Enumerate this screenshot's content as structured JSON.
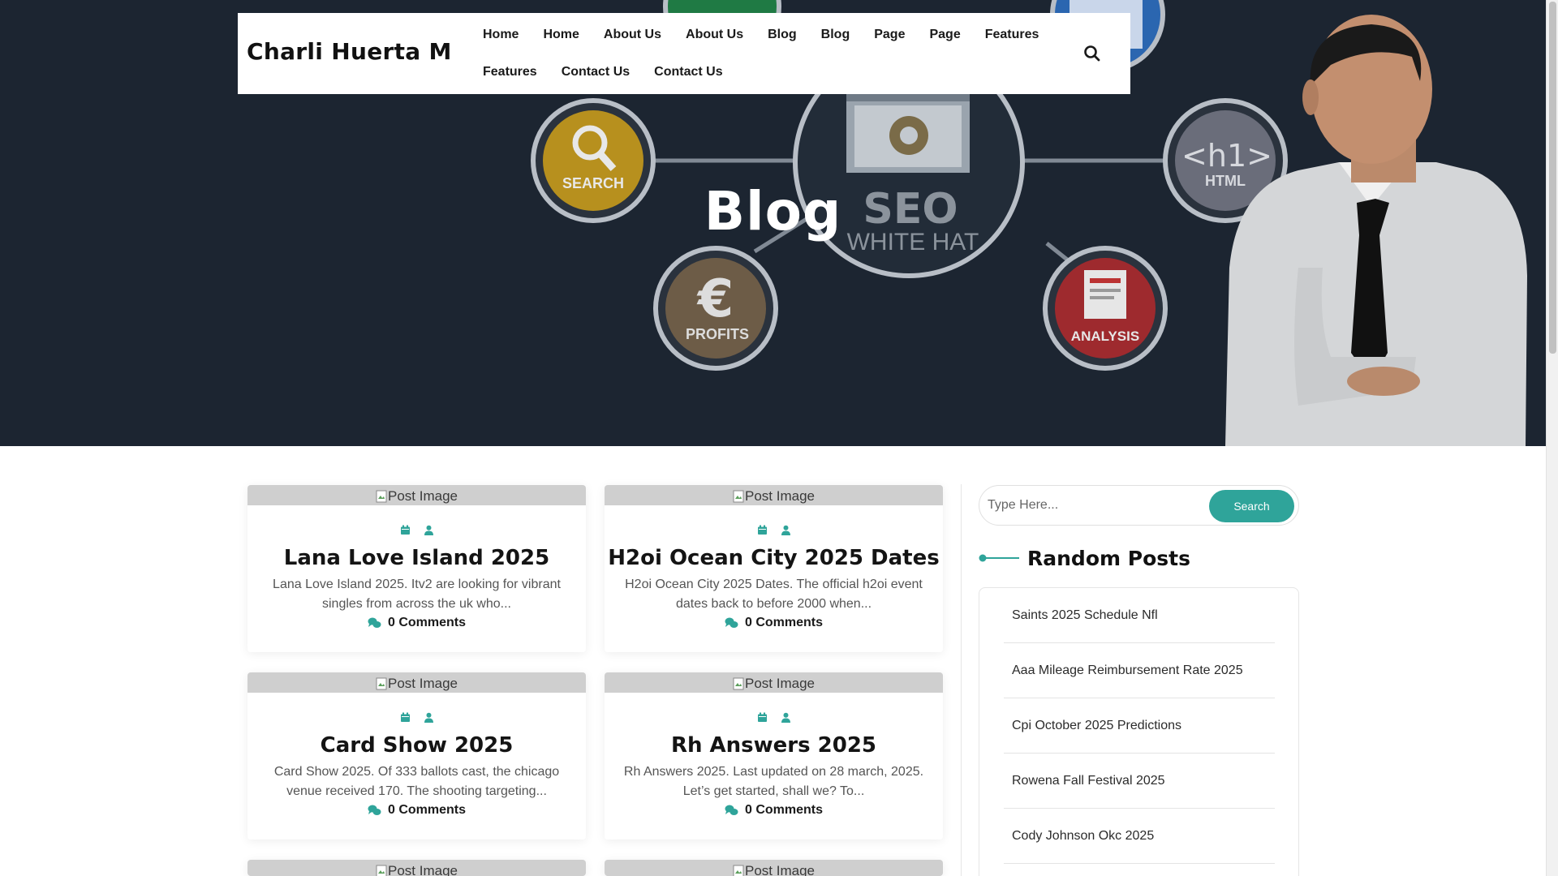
{
  "site": {
    "title": "Charli Huerta M"
  },
  "nav": {
    "row1": [
      "Home",
      "Home",
      "About Us",
      "About Us",
      "Blog",
      "Blog",
      "Page",
      "Page",
      "Features"
    ],
    "row2": [
      "Features",
      "Contact Us",
      "Contact Us"
    ]
  },
  "hero": {
    "title": "Blog",
    "art_labels": {
      "search": "SEARCH",
      "seo": "SEO",
      "whitehat": "WHITE HAT",
      "html_tag": "<h1>",
      "html": "HTML",
      "profits": "PROFITS",
      "analysis": "ANALYSIS",
      "euro": "€"
    }
  },
  "posts": [
    {
      "image_alt": "Post Image",
      "title": "Lana Love Island 2025",
      "excerpt_line1": "Lana Love Island 2025. Itv2 are looking for vibrant",
      "excerpt_line2": "singles from across the uk who...",
      "comments": "0 Comments"
    },
    {
      "image_alt": "Post Image",
      "title": "H2oi Ocean City 2025 Dates",
      "excerpt_line1": "H2oi Ocean City 2025 Dates. The official h2oi event",
      "excerpt_line2": "dates back to before 2000 when...",
      "comments": "0 Comments"
    },
    {
      "image_alt": "Post Image",
      "title": "Card Show 2025",
      "excerpt_line1": "Card Show 2025. Of 333 ballots cast, the chicago",
      "excerpt_line2": "venue received 170. The shooting targeting...",
      "comments": "0 Comments"
    },
    {
      "image_alt": "Post Image",
      "title": "Rh Answers 2025",
      "excerpt_line1": "Rh Answers 2025. Last updated on 28 march, 2025.",
      "excerpt_line2": "Let’s get started, shall we? To...",
      "comments": "0 Comments"
    },
    {
      "image_alt": "Post Image"
    },
    {
      "image_alt": "Post Image"
    }
  ],
  "sidebar": {
    "search": {
      "placeholder": "Type Here...",
      "button": "Search"
    },
    "random_title": "Random Posts",
    "random_posts": [
      "Saints 2025 Schedule Nfl",
      "Aaa Mileage Reimbursement Rate 2025",
      "Cpi October 2025 Predictions",
      "Rowena Fall Festival 2025",
      "Cody Johnson Okc 2025"
    ]
  },
  "colors": {
    "accent": "#2fa49a",
    "hero_bg": "#1c2531"
  }
}
